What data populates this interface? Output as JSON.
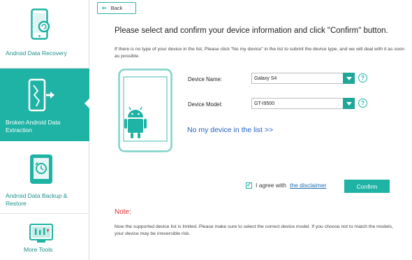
{
  "sidebar": {
    "items": [
      {
        "label": "Android Data Recovery",
        "icon": "phone-recovery-icon",
        "active": false
      },
      {
        "label": "Broken Android Data Extraction",
        "icon": "broken-phone-extract-icon",
        "active": true
      },
      {
        "label": "Android Data Backup & Restore",
        "icon": "backup-restore-icon",
        "active": false
      },
      {
        "label": "More Tools",
        "icon": "toolbox-icon",
        "active": false
      }
    ]
  },
  "toolbar": {
    "back_label": "Back"
  },
  "main": {
    "title": "Please select and confirm your device information and click \"Confirm\" button.",
    "info_text": "If there is no type of your device in the list, Please click \"No my device\" in the list to submit the device type, and we will deal with it as soon as possible.",
    "device_name_label": "Device Name:",
    "device_name_value": "Galaxy S4",
    "device_model_label": "Device Model:",
    "device_model_value": "GT-I9500",
    "help_glyph": "?",
    "no_device_link": "No my device in the list >>",
    "agree_text": "I agree with",
    "disclaimer_link": "the disclaimer",
    "confirm_label": "Confirm",
    "agree_checked": true,
    "note_title": "Note:",
    "note_text": "Now the supported device list is limited. Please make sure to select the correct device model. If you choose not to match the models, your device may be irreversible risk."
  },
  "colors": {
    "accent": "#1fb3a5",
    "link": "#2561c0",
    "note": "#e03030",
    "android_green": "#1fb3a5"
  }
}
